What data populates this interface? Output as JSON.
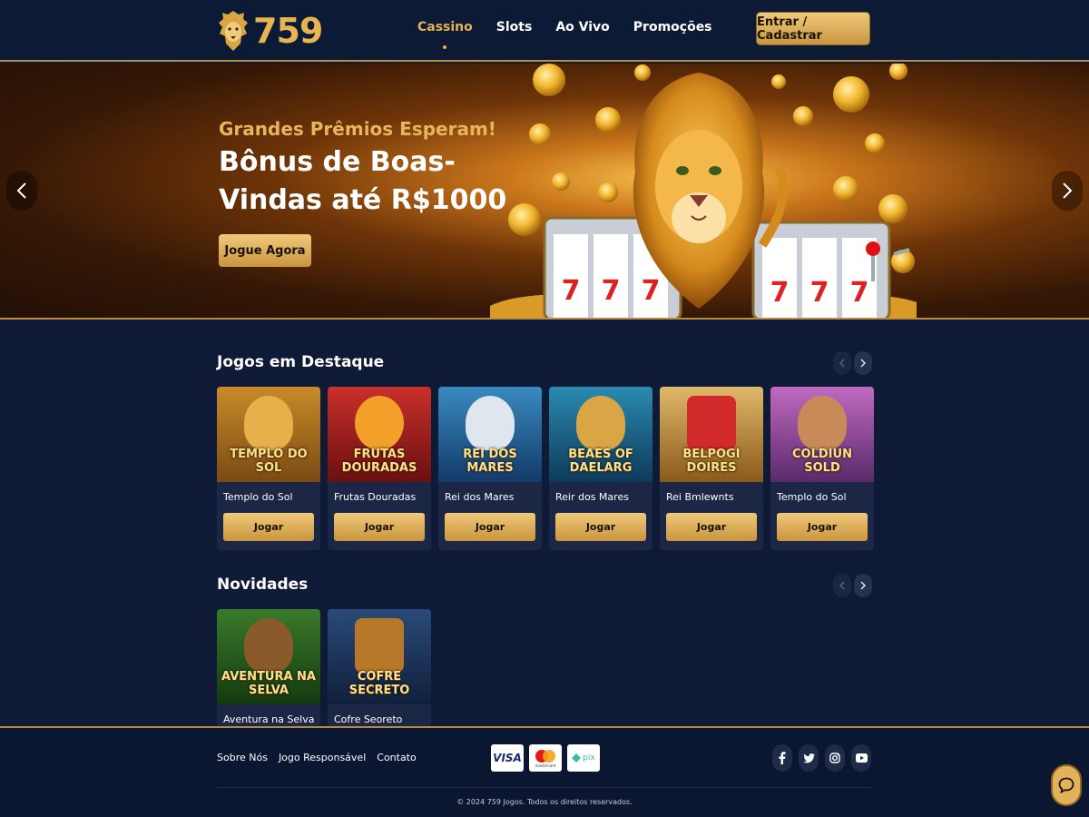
{
  "header": {
    "logo_text": "759",
    "nav": [
      {
        "label": "Cassino",
        "active": true
      },
      {
        "label": "Slots",
        "active": false
      },
      {
        "label": "Ao Vivo",
        "active": false
      },
      {
        "label": "Promoções",
        "active": false
      }
    ],
    "login_label": "Entrar / Cadastrar"
  },
  "hero": {
    "subtitle": "Grandes Prêmios Esperam!",
    "title": "Bônus de Boas-Vindas até R$1000",
    "cta": "Jogue Agora"
  },
  "featured": {
    "title": "Jogos em Destaque",
    "games": [
      {
        "thumb_text": "TEMPLO DO SOL",
        "name": "Templo do Sol",
        "play": "Jogar",
        "icon": "pharaoh-icon"
      },
      {
        "thumb_text": "FRUTAS DOURADAS",
        "name": "Frutas Douradas",
        "play": "Jogar",
        "icon": "fruits-icon"
      },
      {
        "thumb_text": "REI DOS MARES",
        "name": "Rei dos Mares",
        "play": "Jogar",
        "icon": "poseidon-icon"
      },
      {
        "thumb_text": "BEAES OF DAELARG",
        "name": "Reir dos Mares",
        "play": "Jogar",
        "icon": "mermaid-icon"
      },
      {
        "thumb_text": "BELPOGI DOIRES",
        "name": "Rei Bmlewnts",
        "play": "Jogar",
        "icon": "sevens-icon"
      },
      {
        "thumb_text": "COLDIUN SOLD",
        "name": "Templo do Sol",
        "play": "Jogar",
        "icon": "king-icon"
      }
    ]
  },
  "new_games": {
    "title": "Novidades",
    "games": [
      {
        "thumb_text": "AVENTURA NA SELVA",
        "name": "Aventura na Selva",
        "icon": "explorer-icon"
      },
      {
        "thumb_text": "COFRE SECRETO",
        "name": "Cofre Seoreto",
        "icon": "chest-icon"
      }
    ]
  },
  "footer": {
    "links": [
      "Sobre Nós",
      "Jogo Responsável",
      "Contato"
    ],
    "payments": [
      "VISA",
      "mastercard",
      "pix"
    ],
    "socials": [
      "facebook-icon",
      "twitter-icon",
      "instagram-icon",
      "youtube-icon"
    ],
    "copyright": "© 2024 759 Jogos. Todos os direitos reservados."
  },
  "colors": {
    "background": "#0e1a36",
    "gold": "#e3b356",
    "card": "#1b2745"
  }
}
